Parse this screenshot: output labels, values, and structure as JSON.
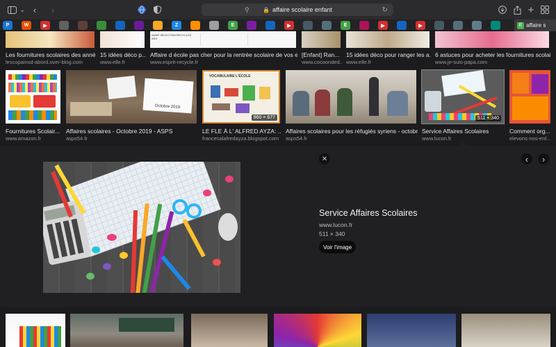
{
  "address_bar": {
    "url_text": "affaire scolaire enfant"
  },
  "tabs": {
    "active_label": "affaire s",
    "favicons": [
      {
        "letter": "P",
        "color": "#1976d2"
      },
      {
        "letter": "W",
        "color": "#e65100"
      },
      {
        "letter": "▶",
        "color": "#d32f2f"
      },
      {
        "letter": "",
        "color": "#616161"
      },
      {
        "letter": "",
        "color": "#5d4037"
      },
      {
        "letter": "",
        "color": "#388e3c"
      },
      {
        "letter": "",
        "color": "#1565c0"
      },
      {
        "letter": "",
        "color": "#6a1b9a"
      },
      {
        "letter": "",
        "color": "#f9a825"
      },
      {
        "letter": "Z",
        "color": "#1e88e5"
      },
      {
        "letter": "",
        "color": "#ff8f00"
      },
      {
        "letter": "",
        "color": "#9e9e9e"
      },
      {
        "letter": "E",
        "color": "#43a047"
      },
      {
        "letter": "",
        "color": "#7b1fa2"
      },
      {
        "letter": "",
        "color": "#1565c0"
      },
      {
        "letter": "▶",
        "color": "#d32f2f"
      },
      {
        "letter": "",
        "color": "#455a64"
      },
      {
        "letter": "",
        "color": "#546e7a"
      },
      {
        "letter": "E",
        "color": "#43a047"
      },
      {
        "letter": "",
        "color": "#ad1457"
      },
      {
        "letter": "▶",
        "color": "#d32f2f"
      },
      {
        "letter": "",
        "color": "#1565c0"
      },
      {
        "letter": "▶",
        "color": "#d32f2f"
      },
      {
        "letter": "",
        "color": "#455a64"
      },
      {
        "letter": "",
        "color": "#546e7a"
      },
      {
        "letter": "",
        "color": "#607d8b"
      },
      {
        "letter": "",
        "color": "#00897b"
      }
    ]
  },
  "row1": [
    {
      "caption": "Les fournitures scolaires des anné...",
      "source": "lescopainsd-abord.over-blog.com"
    },
    {
      "caption": "15 idées déco p...",
      "source": "www.elle.fr"
    },
    {
      "caption": "Affaire d école pas cher pour la rentrée scolaire de vos enf...",
      "source": "www.esprit-recycle.fr"
    },
    {
      "caption": "[Enfant] Ran...",
      "source": "www.cocoonded..."
    },
    {
      "caption": "15 idées déco pour ranger les a...",
      "source": "www.elle.fr"
    },
    {
      "caption": "6 astuces pour acheter les fournitures scolair...",
      "source": "www.je-suis-papa.com"
    }
  ],
  "row2": [
    {
      "caption": "Fournitures Scolair...",
      "source": "www.amazon.fr"
    },
    {
      "caption": "Affaires scolaires - Octobre 2019 - ASPS",
      "source": "asps54.fr"
    },
    {
      "caption": "LE FLE À L' ALFRED AYZA: ...",
      "source": "francesalafredayza.blogspot.com",
      "dims": "960 × 677"
    },
    {
      "caption": "Affaires scolaires pour les réfugiés syriens - octobre...",
      "source": "asps54.fr"
    },
    {
      "caption": "Service Affaires Scolaires",
      "source": "www.lucon.fr",
      "dims": "511 × 340"
    },
    {
      "caption": "Comment org...",
      "source": "elevons-nos-enf..."
    }
  ],
  "thumb_texts": {
    "sheet_label_a": "Octobre 2019",
    "vocab_label": "VOCABULAIRE L'ÉCOLE",
    "sheet_label_b": "AUNE SÉLECTION RECYCLEZ ASO"
  },
  "detail": {
    "title": "Service Affaires Scolaires",
    "source": "www.lucon.fr",
    "dims": "511 × 340",
    "view_button": "Voir l'image",
    "close_glyph": "✕",
    "prev_glyph": "‹",
    "next_glyph": "›"
  },
  "colors": {
    "background": "#1c1c1e",
    "panel": "#202022",
    "accent": "#3a3a3c"
  }
}
